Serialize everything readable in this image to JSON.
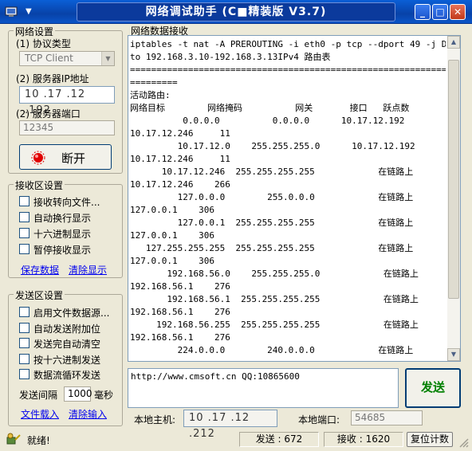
{
  "window": {
    "title": "网络调试助手 (C■精装版 V3.7)"
  },
  "network": {
    "group_title": "网络设置",
    "protocol_label": "(1) 协议类型",
    "protocol_value": "TCP Client",
    "ip_label": "(2) 服务器IP地址",
    "ip_value": "10 .17 .12 .192",
    "port_label": "(2) 服务器端口",
    "port_value": "12345",
    "disconnect_label": "断开"
  },
  "receive_settings": {
    "group_title": "接收区设置",
    "options": [
      "接收转向文件...",
      "自动换行显示",
      "十六进制显示",
      "暂停接收显示"
    ],
    "save_link": "保存数据",
    "clear_link": "清除显示"
  },
  "send_settings": {
    "group_title": "发送区设置",
    "options": [
      "启用文件数据源...",
      "自动发送附加位",
      "发送完自动清空",
      "按十六进制发送",
      "数据流循环发送"
    ],
    "interval_label": "发送间隔",
    "interval_value": "1000",
    "interval_unit": "毫秒",
    "file_link": "文件载入",
    "clear_link": "清除输入"
  },
  "receive_area": {
    "group_title": "网络数据接收",
    "text": "iptables -t nat -A PREROUTING -i eth0 -p tcp --dport 49 -j DNAT --\nto 192.168.3.10-192.168.3.13IPv4 路由表\n=====================================================================\n=========\n活动路由:\n网络目标        网络掩码          网关       接口   跃点数\n          0.0.0.0          0.0.0.0      10.17.12.192\n10.17.12.246     11\n         10.17.12.0    255.255.255.0      10.17.12.192\n10.17.12.246     11\n      10.17.12.246  255.255.255.255            在链路上\n10.17.12.246    266\n         127.0.0.0        255.0.0.0            在链路上\n127.0.0.1    306\n         127.0.0.1  255.255.255.255            在链路上\n127.0.0.1    306\n   127.255.255.255  255.255.255.255            在链路上\n127.0.0.1    306\n       192.168.56.0    255.255.255.0            在链路上\n192.168.56.1    276\n       192.168.56.1  255.255.255.255            在链路上\n192.168.56.1    276\n     192.168.56.255  255.255.255.255            在链路上\n192.168.56.1    276\n         224.0.0.0        240.0.0.0            在链路上"
  },
  "send_area": {
    "text": "http://www.cmsoft.cn QQ:10865600",
    "send_label": "发送",
    "local_host_label": "本地主机:",
    "local_host_value": "10 .17 .12 .212",
    "local_port_label": "本地端口:",
    "local_port_value": "54685"
  },
  "status": {
    "ready": "就绪!",
    "sent_label": "发送 : 672",
    "received_label": "接收 : 1620",
    "reset_label": "复位计数"
  }
}
